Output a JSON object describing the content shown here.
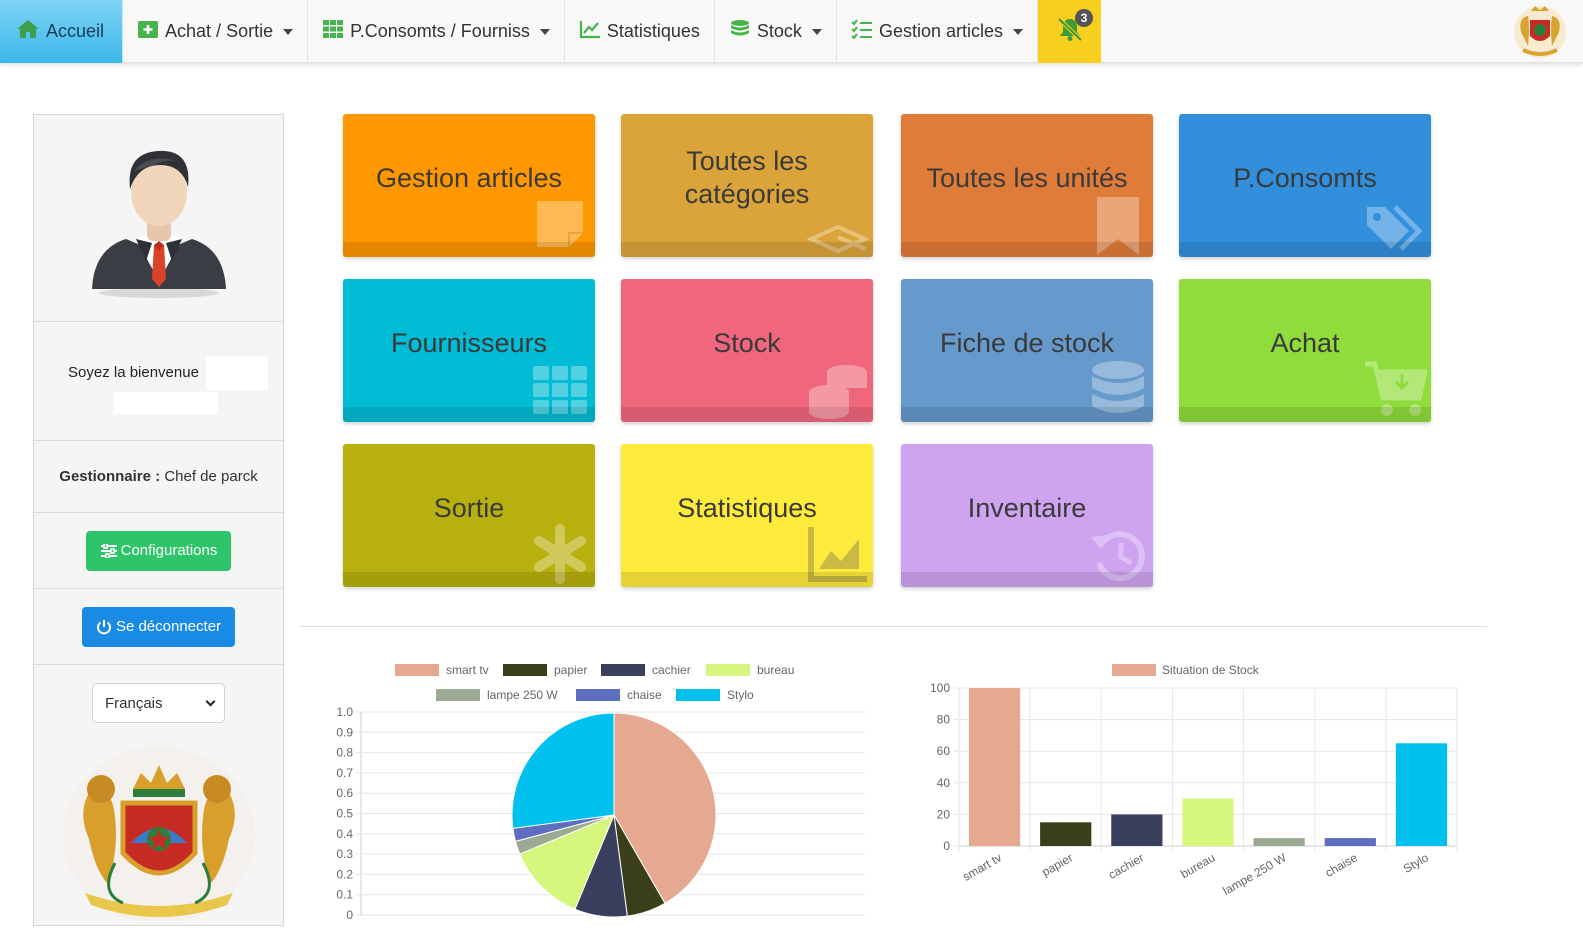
{
  "navbar": {
    "items": [
      {
        "label": "Accueil",
        "icon": "home-icon",
        "active": true,
        "dropdown": false
      },
      {
        "label": "Achat / Sortie",
        "icon": "plus-square-icon",
        "active": false,
        "dropdown": true
      },
      {
        "label": "P.Consomts / Fourniss",
        "icon": "grid-icon",
        "active": false,
        "dropdown": true
      },
      {
        "label": "Statistiques",
        "icon": "line-chart-icon",
        "active": false,
        "dropdown": false
      },
      {
        "label": "Stock",
        "icon": "database-icon",
        "active": false,
        "dropdown": true
      },
      {
        "label": "Gestion articles",
        "icon": "list-check-icon",
        "active": false,
        "dropdown": true
      }
    ],
    "notifications": {
      "count": "3",
      "icon": "bell-slash-icon"
    },
    "emblem_icon": "coat-of-arms-icon"
  },
  "sidebar": {
    "avatar_icon": "user-avatar-icon",
    "welcome": "Soyez la bienvenue",
    "role_label": "Gestionnaire :",
    "role_value": "Chef de parck",
    "config_button": "Configurations",
    "logout_button": "Se déconnecter",
    "language": "Français",
    "emblem_icon": "coat-of-arms-icon"
  },
  "tiles": [
    {
      "title": "Gestion articles",
      "color": "#ff9800",
      "icon": "sticky-note-icon"
    },
    {
      "title": "Toutes les catégories",
      "color": "#dba43a",
      "icon": "layers-icon"
    },
    {
      "title": "Toutes les unités",
      "color": "#e07c3a",
      "icon": "bookmark-icon"
    },
    {
      "title": "P.Consomts",
      "color": "#318fdc",
      "icon": "tags-icon"
    },
    {
      "title": "Fournisseurs",
      "color": "#00bcd4",
      "icon": "grid-icon"
    },
    {
      "title": "Stock",
      "color": "#f0677d",
      "icon": "coins-icon"
    },
    {
      "title": "Fiche de stock",
      "color": "#6699cc",
      "icon": "database-icon"
    },
    {
      "title": "Achat",
      "color": "#90dc3a",
      "icon": "cart-download-icon"
    },
    {
      "title": "Sortie",
      "color": "#b8b00e",
      "icon": "asterisk-icon"
    },
    {
      "title": "Statistiques",
      "color": "#ffeb3b",
      "icon": "area-chart-icon"
    },
    {
      "title": "Inventaire",
      "color": "#cea3f0",
      "icon": "history-icon"
    }
  ],
  "chart_data": [
    {
      "type": "pie",
      "categories": [
        "smart tv",
        "papier",
        "cachier",
        "bureau",
        "lampe 250 W",
        "chaise",
        "Stylo"
      ],
      "values": [
        100,
        15,
        20,
        30,
        5,
        5,
        65
      ],
      "colors": [
        "#e5a992",
        "#3a3f1a",
        "#3a3f5e",
        "#d5f77d",
        "#9daa93",
        "#5e6ebf",
        "#00c0ed"
      ],
      "ylim": [
        0,
        1.0
      ],
      "yticks": [
        "0",
        "0.1",
        "0.2",
        "0.3",
        "0.4",
        "0.5",
        "0.6",
        "0.7",
        "0.8",
        "0.9",
        "1.0"
      ],
      "legend": "top",
      "grid": true
    },
    {
      "type": "bar",
      "categories": [
        "smart tv",
        "papier",
        "cachier",
        "bureau",
        "lampe 250 W",
        "chaise",
        "Stylo"
      ],
      "series": [
        {
          "name": "Situation de Stock",
          "values": [
            100,
            15,
            20,
            30,
            5,
            5,
            65
          ]
        }
      ],
      "colors": [
        "#e5a992",
        "#3a3f1a",
        "#3a3f5e",
        "#d5f77d",
        "#9daa93",
        "#5e6ebf",
        "#00c0ed"
      ],
      "ylim": [
        0,
        100
      ],
      "yticks": [
        "0",
        "20",
        "40",
        "60",
        "80",
        "100"
      ],
      "legend": "top",
      "grid": true
    }
  ]
}
